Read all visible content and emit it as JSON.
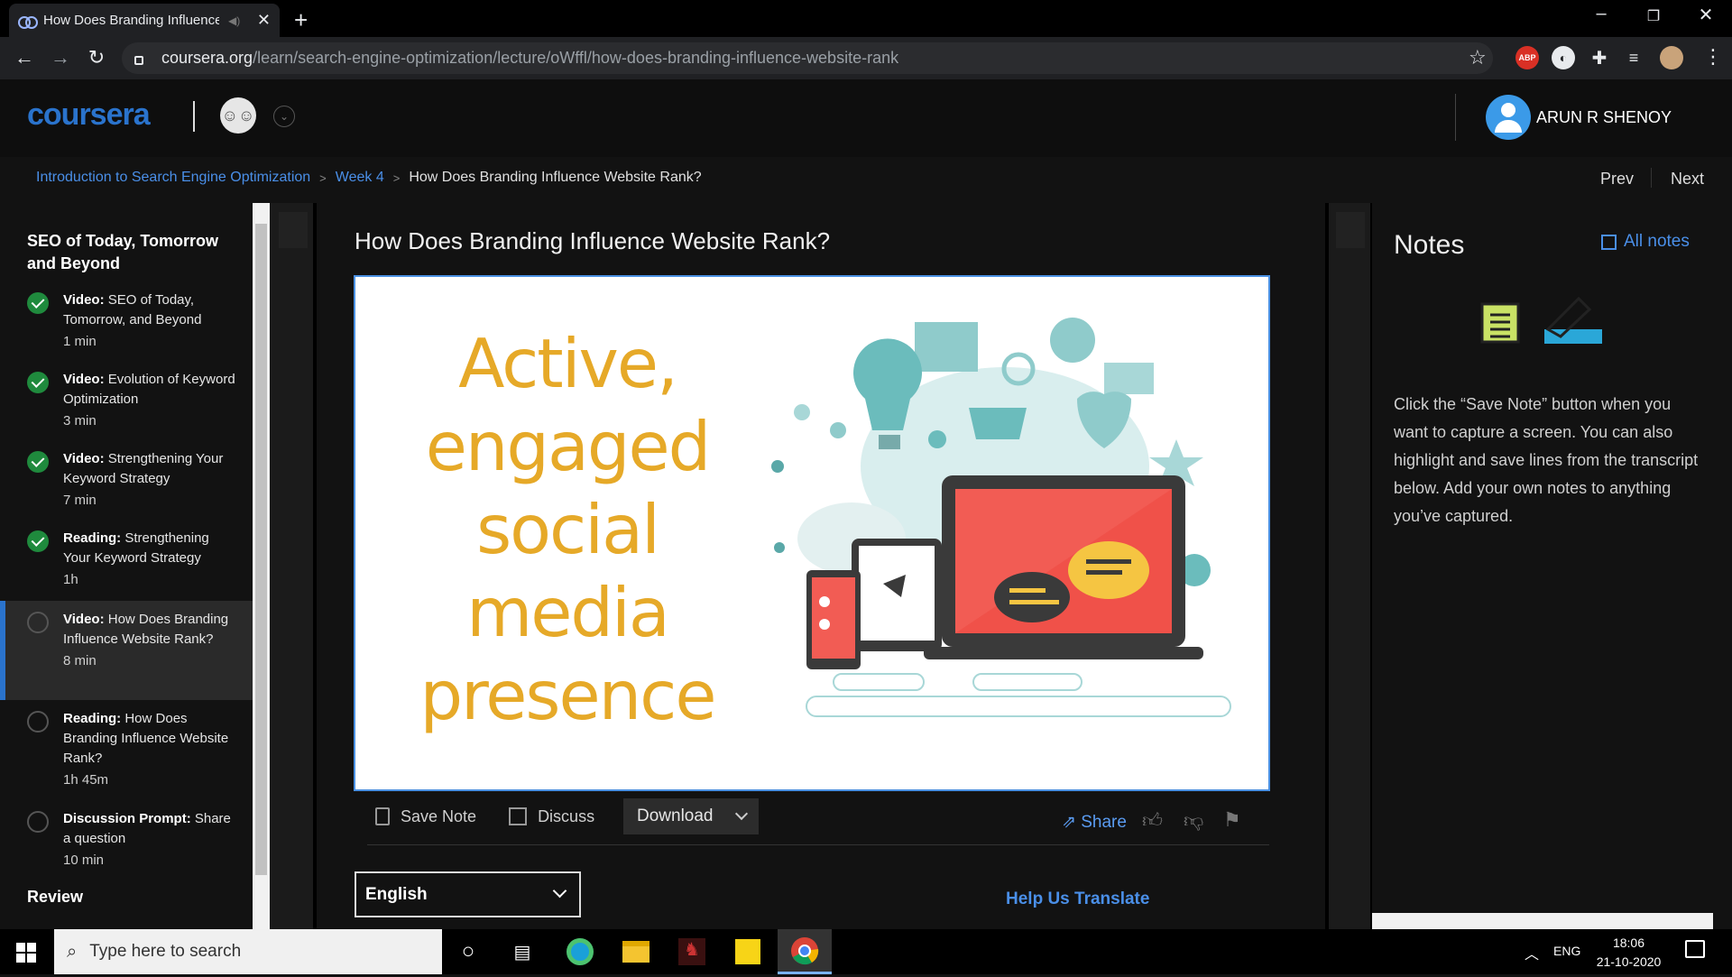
{
  "browser": {
    "tab_title": "How Does Branding Influence",
    "new_tab": "+",
    "close_tab": "✕",
    "url_host": "coursera.org",
    "url_path": "/learn/search-engine-optimization/lecture/oWffl/how-does-branding-influence-website-rank",
    "ext_abp": "ABP"
  },
  "header": {
    "logo": "coursera",
    "username": "ARUN R SHENOY"
  },
  "breadcrumb": {
    "course": "Introduction to Search Engine Optimization",
    "week": "Week 4",
    "current": "How Does Branding Influence Website Rank?",
    "sep": ">"
  },
  "pager": {
    "prev": "Prev",
    "next": "Next"
  },
  "sidebar": {
    "week_title": "SEO of Today, Tomorrow and Beyond",
    "items": [
      {
        "type": "Video:",
        "title": "SEO of Today, Tomorrow, and Beyond",
        "duration": "1 min",
        "done": true
      },
      {
        "type": "Video:",
        "title": "Evolution of Keyword Optimization",
        "duration": "3 min",
        "done": true
      },
      {
        "type": "Video:",
        "title": "Strengthening Your Keyword Strategy",
        "duration": "7 min",
        "done": true
      },
      {
        "type": "Reading:",
        "title": "Strengthening Your Keyword Strategy",
        "duration": "1h",
        "done": true
      },
      {
        "type": "Video:",
        "title": "How Does Branding Influence Website Rank?",
        "duration": "8 min",
        "done": false
      },
      {
        "type": "Reading:",
        "title": "How Does Branding Influence Website Rank?",
        "duration": "1h 45m",
        "done": false
      },
      {
        "type": "Discussion Prompt:",
        "title": "Share a question",
        "duration": "10 min",
        "done": false
      }
    ],
    "review": "Review"
  },
  "main": {
    "title": "How Does Branding Influence Website Rank?",
    "slide_lines": [
      "Active,",
      "engaged",
      "social",
      "media",
      "presence"
    ],
    "save_note": "Save Note",
    "discuss": "Discuss",
    "download": "Download",
    "share": "Share",
    "language": "English",
    "help_translate": "Help Us Translate"
  },
  "notes": {
    "title": "Notes",
    "all_notes": "All notes",
    "description": "Click the “Save Note” button when you want to capture a screen. You can also highlight and save lines from the transcript below. Add your own notes to anything you’ve captured."
  },
  "taskbar": {
    "search_placeholder": "Type here to search",
    "lang": "ENG",
    "time": "18:06",
    "date": "21-10-2020"
  },
  "colors": {
    "brand_blue": "#2a73cc",
    "link_blue": "#4a8fe8",
    "done_green": "#1f8a3d",
    "slide_orange": "#e6a928"
  }
}
